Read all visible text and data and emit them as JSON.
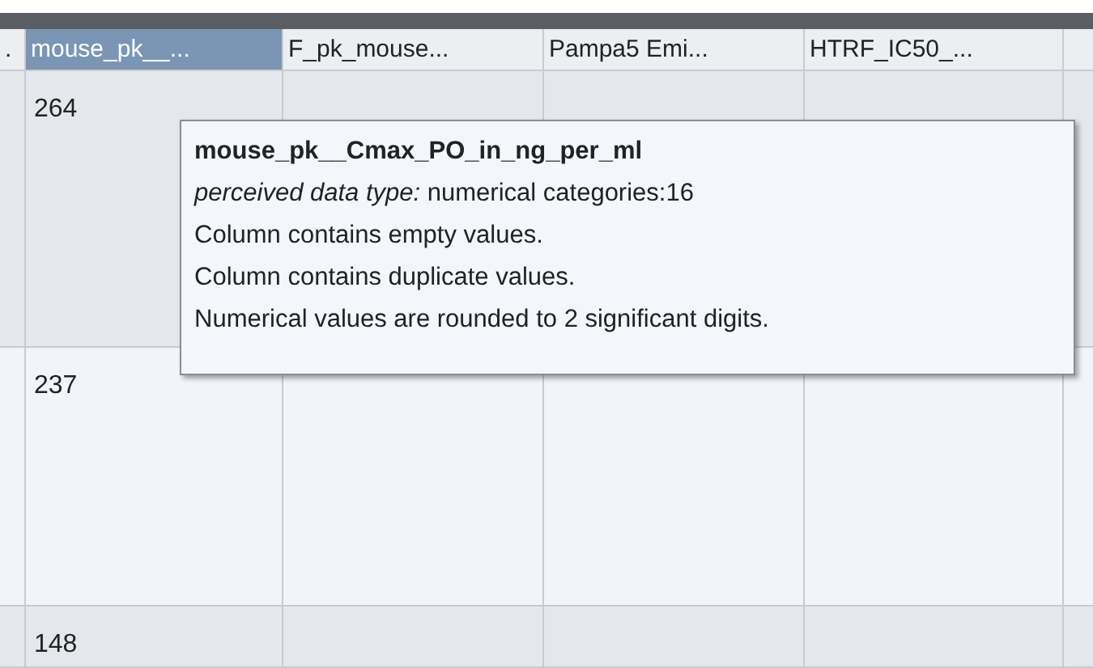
{
  "table": {
    "columns": [
      {
        "label": ".",
        "selected": false
      },
      {
        "label": "mouse_pk__...",
        "selected": true
      },
      {
        "label": "F_pk_mouse...",
        "selected": false
      },
      {
        "label": "Pampa5 Emi...",
        "selected": false
      },
      {
        "label": "HTRF_IC50_...",
        "selected": false
      }
    ],
    "rows": [
      {
        "cells": [
          "",
          "264",
          "",
          "",
          ""
        ]
      },
      {
        "cells": [
          "",
          "237",
          "",
          "",
          ""
        ]
      },
      {
        "cells": [
          "",
          "148",
          "",
          "",
          ""
        ]
      }
    ]
  },
  "tooltip": {
    "title": "mouse_pk__Cmax_PO_in_ng_per_ml",
    "type_label": "perceived data type:",
    "type_value": " numerical categories:16",
    "lines": [
      "Column contains empty values.",
      "Column contains duplicate values.",
      "Numerical values are rounded to 2 significant digits."
    ]
  }
}
